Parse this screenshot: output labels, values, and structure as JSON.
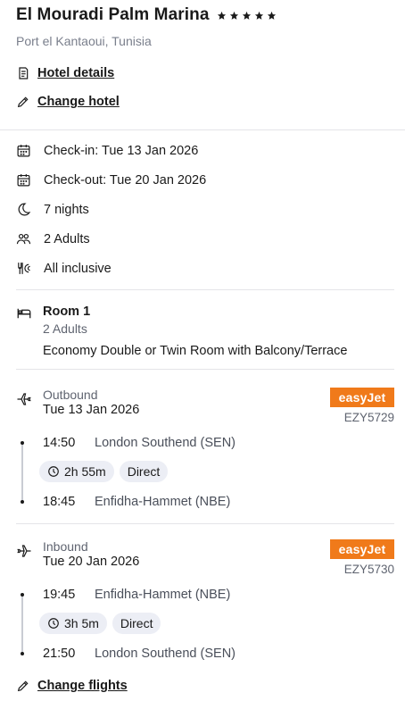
{
  "hotel": {
    "name": "El Mouradi Palm Marina",
    "stars": 5,
    "location": "Port el Kantaoui, Tunisia",
    "details_link": "Hotel details",
    "change_link": "Change hotel"
  },
  "stay": {
    "checkin": "Check-in: Tue 13 Jan 2026",
    "checkout": "Check-out: Tue 20 Jan 2026",
    "nights": "7 nights",
    "guests": "2 Adults",
    "board": "All inclusive"
  },
  "room": {
    "title": "Room 1",
    "occupancy": "2 Adults",
    "description": "Economy Double or Twin Room with Balcony/Terrace"
  },
  "flights": {
    "outbound": {
      "direction": "Outbound",
      "date": "Tue 13 Jan 2026",
      "airline": "easyJet",
      "flight_number": "EZY5729",
      "depart_time": "14:50",
      "depart_airport": "London Southend (SEN)",
      "duration": "2h 55m",
      "stops": "Direct",
      "arrive_time": "18:45",
      "arrive_airport": "Enfidha-Hammet (NBE)"
    },
    "inbound": {
      "direction": "Inbound",
      "date": "Tue 20 Jan 2026",
      "airline": "easyJet",
      "flight_number": "EZY5730",
      "depart_time": "19:45",
      "depart_airport": "Enfidha-Hammet (NBE)",
      "duration": "3h 5m",
      "stops": "Direct",
      "arrive_time": "21:50",
      "arrive_airport": "London Southend (SEN)"
    },
    "change_link": "Change flights"
  },
  "colors": {
    "airline_brand": "#f07a1a",
    "chip_bg": "#eceef5",
    "muted_text": "#7a7f8c"
  }
}
